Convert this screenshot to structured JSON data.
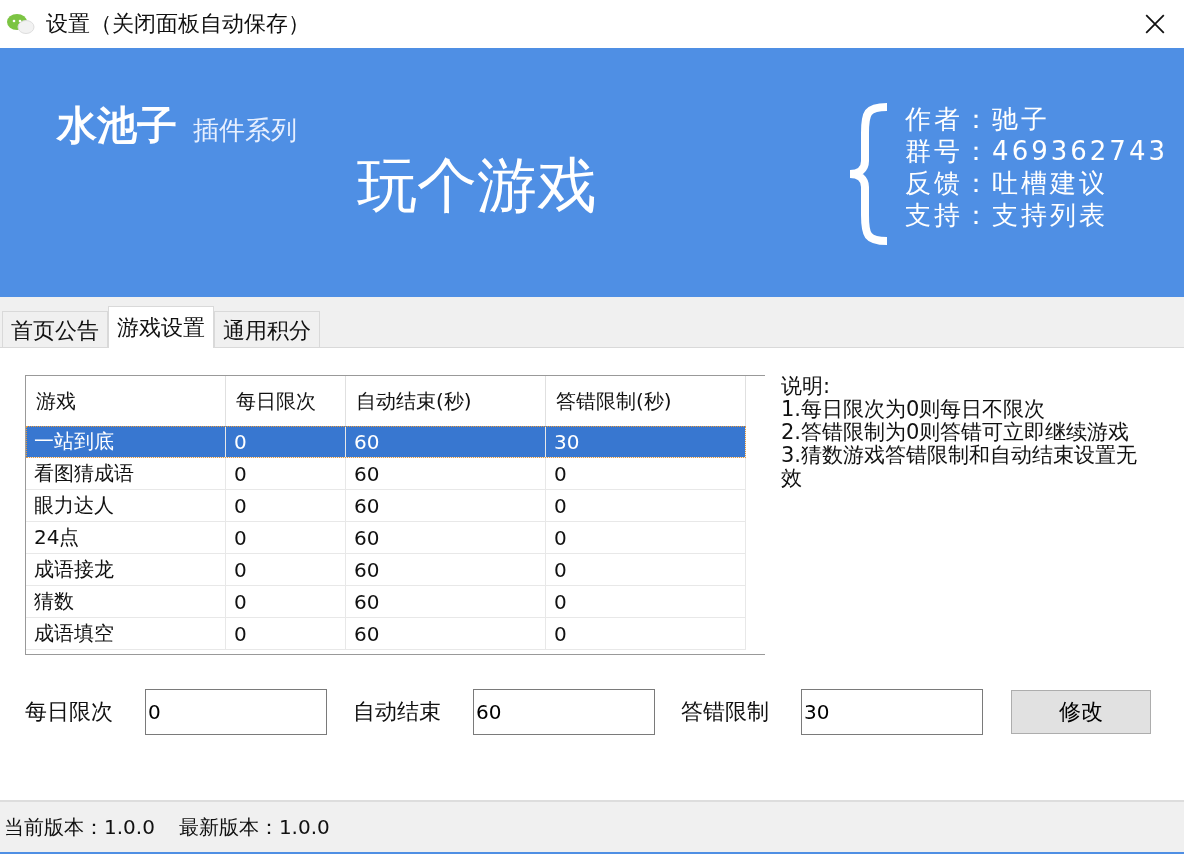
{
  "window": {
    "title": "设置（关闭面板自动保存）"
  },
  "banner": {
    "logo": "水池子",
    "subtitle": "插件系列",
    "headline": "玩个游戏",
    "info": [
      {
        "label": "作者：",
        "value": "驰子"
      },
      {
        "label": "群号：",
        "value": "469362743"
      },
      {
        "label": "反馈：",
        "value": "吐槽建议"
      },
      {
        "label": "支持：",
        "value": "支持列表"
      }
    ]
  },
  "tabs": [
    {
      "label": "首页公告",
      "selected": false
    },
    {
      "label": "游戏设置",
      "selected": true
    },
    {
      "label": "通用积分",
      "selected": false
    }
  ],
  "table": {
    "columns": [
      "游戏",
      "每日限次",
      "自动结束(秒)",
      "答错限制(秒)"
    ],
    "rows": [
      {
        "cells": [
          "一站到底",
          "0",
          "60",
          "30"
        ],
        "selected": true
      },
      {
        "cells": [
          "看图猜成语",
          "0",
          "60",
          "0"
        ],
        "selected": false
      },
      {
        "cells": [
          "眼力达人",
          "0",
          "60",
          "0"
        ],
        "selected": false
      },
      {
        "cells": [
          "24点",
          "0",
          "60",
          "0"
        ],
        "selected": false
      },
      {
        "cells": [
          "成语接龙",
          "0",
          "60",
          "0"
        ],
        "selected": false
      },
      {
        "cells": [
          "猜数",
          "0",
          "60",
          "0"
        ],
        "selected": false
      },
      {
        "cells": [
          "成语填空",
          "0",
          "60",
          "0"
        ],
        "selected": false
      }
    ]
  },
  "notes": {
    "title": "说明:",
    "lines": [
      "1.每日限次为0则每日不限次",
      "2.答错限制为0则答错可立即继续游戏",
      "3.猜数游戏答错限制和自动结束设置无效"
    ]
  },
  "form": {
    "fields": [
      {
        "label": "每日限次",
        "value": "0"
      },
      {
        "label": "自动结束",
        "value": "60"
      },
      {
        "label": "答错限制",
        "value": "30"
      }
    ],
    "button": "修改"
  },
  "status_bar": [
    "当前版本：1.0.0",
    "最新版本：1.0.0"
  ]
}
